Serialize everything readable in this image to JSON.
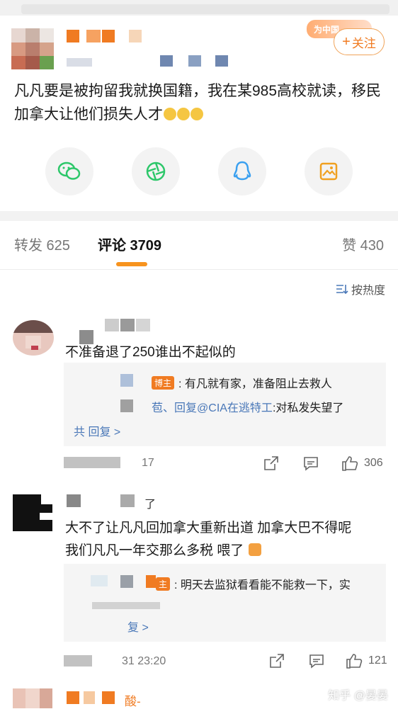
{
  "header": {
    "follow_label": "关注",
    "badge_text": "为中国"
  },
  "post": {
    "text": "凡凡要是被拘留我就换国籍，我在某985高校就读，移民加拿大让他们损失人才"
  },
  "share_icons": [
    "wechat-icon",
    "moments-icon",
    "qq-icon",
    "save-image-icon"
  ],
  "tabs": {
    "reposts": "转发 625",
    "comments": "评论 3709",
    "likes": "赞 430"
  },
  "sort_label": "按热度",
  "comments": [
    {
      "text": "不准备退了250谁出不起似的",
      "replies": [
        {
          "tag": "博主",
          "text": ": 有凡就有家，准备阻止去救人"
        },
        {
          "prefix": "苞、回复",
          "mention": "@CIA在逃特工",
          "text": ":对私发失望了"
        }
      ],
      "more": "共 回复 >",
      "time": "17",
      "likes": "306"
    },
    {
      "name_suffix": "了",
      "text_line1": "大不了让凡凡回加拿大重新出道 加拿大巴不得呢",
      "text_line2": "我们凡凡一年交那么多税 喂了",
      "replies": [
        {
          "tag": "主",
          "text": ": 明天去监狱看看能不能救一下，实"
        }
      ],
      "more": "复 >",
      "time": "31 23:20",
      "likes": "121"
    }
  ],
  "bottom": {
    "name_suffix": "酸-"
  },
  "watermark": "知乎 @晏晏"
}
